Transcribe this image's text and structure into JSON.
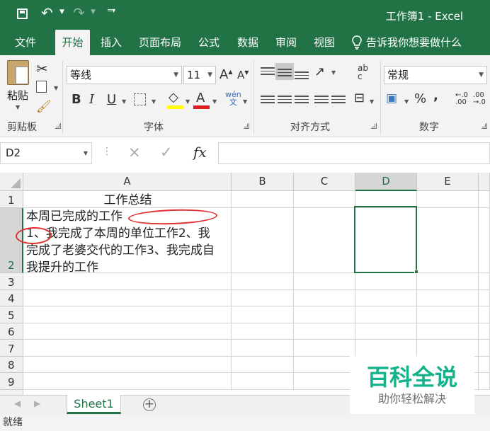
{
  "window": {
    "title": "工作簿1  -  Excel"
  },
  "tabs": [
    {
      "label": "文件"
    },
    {
      "label": "开始",
      "active": true
    },
    {
      "label": "插入"
    },
    {
      "label": "页面布局"
    },
    {
      "label": "公式"
    },
    {
      "label": "数据"
    },
    {
      "label": "审阅"
    },
    {
      "label": "视图"
    }
  ],
  "tell_me": "告诉我你想要做什么",
  "ribbon": {
    "clipboard": {
      "paste": "粘贴",
      "label": "剪贴板"
    },
    "font": {
      "name": "等线",
      "size": "11",
      "grow": "A",
      "shrink": "A",
      "bold": "B",
      "italic": "I",
      "underline": "U",
      "color_letter": "A",
      "phonetic": "wén\n文",
      "label": "字体"
    },
    "alignment": {
      "label": "对齐方式",
      "wrap": "ab\nc"
    },
    "number": {
      "format": "常规",
      "percent": "%",
      "comma": ",",
      "increase": "←.0\n.00",
      "decrease": ".00\n→.0",
      "label": "数字"
    }
  },
  "formula_bar": {
    "name_box": "D2",
    "fx": "fx",
    "formula": ""
  },
  "columns": [
    {
      "label": "A"
    },
    {
      "label": "B"
    },
    {
      "label": "C"
    },
    {
      "label": "D",
      "active": true
    },
    {
      "label": "E"
    }
  ],
  "rows": [
    "1",
    "2",
    "3",
    "4",
    "5",
    "6",
    "7",
    "8",
    "9"
  ],
  "cells": {
    "A1": "工作总结",
    "A2_lines": [
      "本周已完成的工作",
      "1、我完成了本周的单位工作2、我",
      "完成了老婆交代的工作3、我完成自",
      "我提升的工作"
    ]
  },
  "sheet": {
    "tab": "Sheet1",
    "add": "+"
  },
  "status": {
    "text": "就绪"
  },
  "watermark": {
    "title": "百科全说",
    "subtitle": "助你轻松解决"
  },
  "colors": {
    "excel_green": "#217346",
    "annotation_red": "#e03030",
    "watermark_green": "#13b28a"
  },
  "icons": [
    "save-icon",
    "undo-icon",
    "redo-icon",
    "customize-quick-access-icon",
    "lightbulb-icon",
    "paste-icon",
    "cut-icon",
    "copy-icon",
    "format-painter-icon",
    "borders-icon",
    "fill-color-icon",
    "font-color-icon",
    "alignment-icons",
    "merge-center-icon",
    "currency-icon",
    "add-sheet-icon"
  ]
}
